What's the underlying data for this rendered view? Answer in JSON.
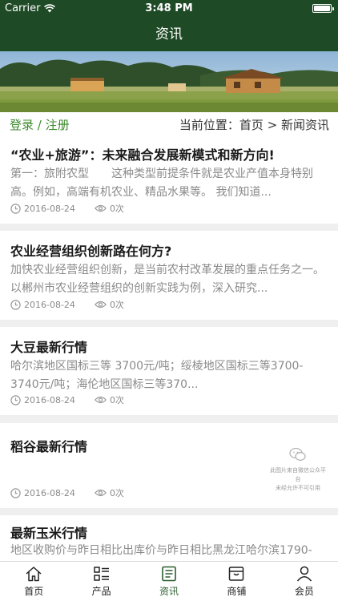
{
  "status_bar": {
    "carrier": "Carrier",
    "time": "3:48 PM"
  },
  "nav": {
    "title": "资讯"
  },
  "location_bar": {
    "login": "登录 / 注册",
    "breadcrumb": "当前位置：首页 > 新闻资讯"
  },
  "articles": [
    {
      "title": "“农业+旅游”：未来融合发展新模式和新方向!",
      "summary": "第一：旅附农型　　这种类型前提条件就是农业产值本身特别高。例如，高端有机农业、精品水果等。 我们知道...",
      "date": "2016-08-24",
      "views": "0次"
    },
    {
      "title": "农业经营组织创新路在何方?",
      "summary": "加快农业经营组织创新，是当前农村改革发展的重点任务之一。以郴州市农业经营组织的创新实践为例，深入研究...",
      "date": "2016-08-24",
      "views": "0次"
    },
    {
      "title": "大豆最新行情",
      "summary": "哈尔滨地区国标三等 3700元/吨；绥棱地区国标三等3700-3740元/吨；海伦地区国标三等370...",
      "date": "2016-08-24",
      "views": "0次"
    },
    {
      "title": "稻谷最新行情",
      "summary": "",
      "date": "2016-08-24",
      "views": "0次",
      "watermark": [
        "此图片来自微信公众平台",
        "未经允许不可引用"
      ]
    },
    {
      "title": "最新玉米行情",
      "summary": "地区收购价与昨日相比出库价与昨日相比黑龙江哈尔滨1790-"
    }
  ],
  "tabs": [
    {
      "label": "首页",
      "icon": "home-icon"
    },
    {
      "label": "产品",
      "icon": "list-icon"
    },
    {
      "label": "资讯",
      "icon": "news-icon",
      "active": true
    },
    {
      "label": "商铺",
      "icon": "shop-icon"
    },
    {
      "label": "会员",
      "icon": "user-icon"
    }
  ],
  "colors": {
    "header": "#1f4a26",
    "accent": "#3d8a2e",
    "active_tab": "#2b5e2f"
  }
}
